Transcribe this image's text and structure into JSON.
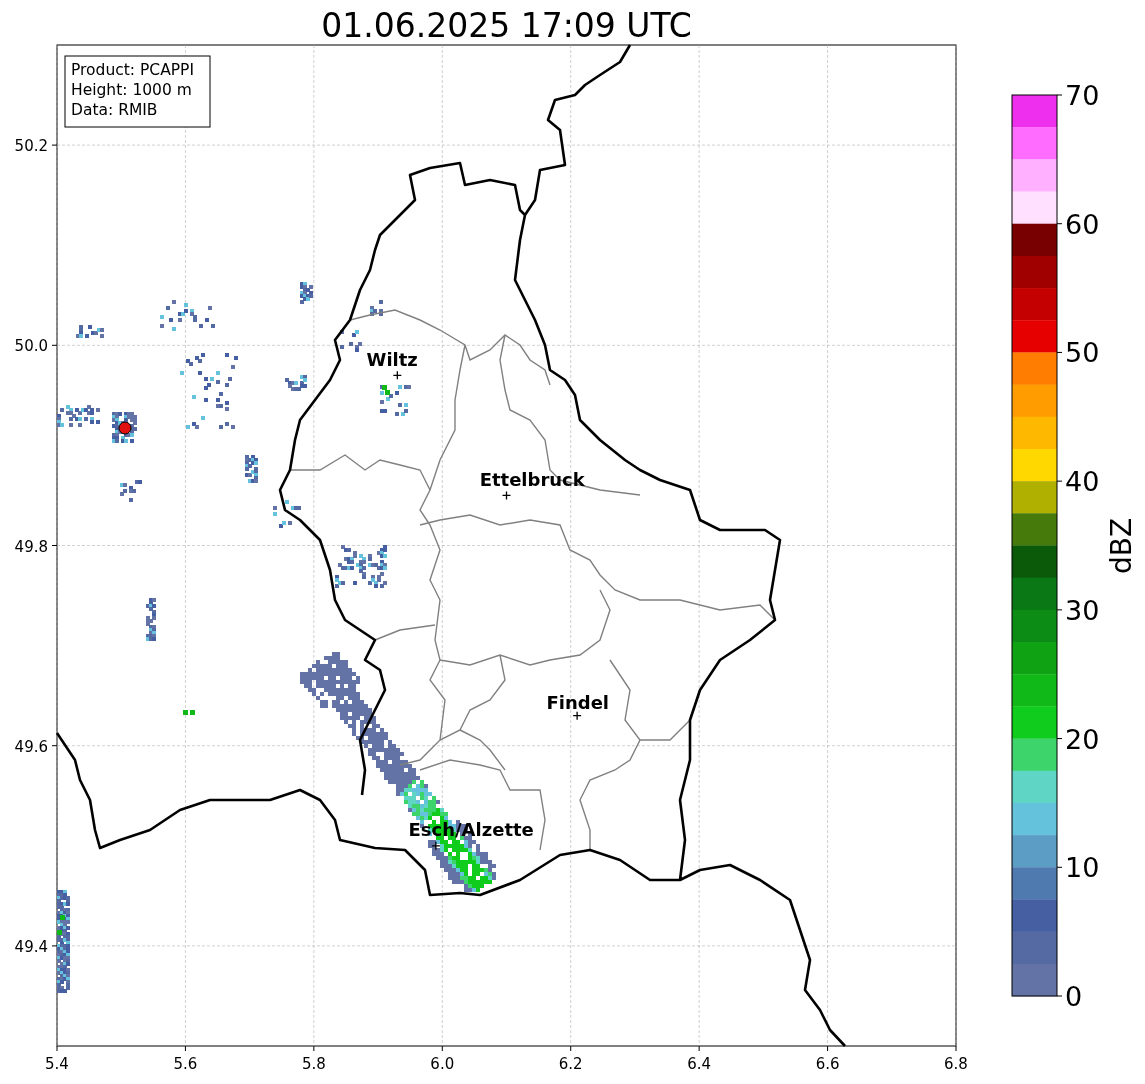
{
  "title": "01.06.2025 17:09 UTC",
  "info_box": [
    "Product: PCAPPI",
    "Height: 1000 m",
    "Data: RMIB"
  ],
  "map": {
    "x_ticks": [
      "5.4",
      "5.6",
      "5.8",
      "6.0",
      "6.2",
      "6.4",
      "6.6",
      "6.8"
    ],
    "y_ticks": [
      "50.2",
      "50.0",
      "49.8",
      "49.6",
      "49.4"
    ],
    "cities": [
      {
        "label": "Wiltz"
      },
      {
        "label": "Ettelbruck"
      },
      {
        "label": "Findel"
      },
      {
        "label": "Esch/Alzette"
      }
    ]
  },
  "colorbar": {
    "label": "dBZ",
    "ticks": [
      "70",
      "60",
      "50",
      "40",
      "30",
      "20",
      "10",
      "0"
    ],
    "bins": [
      {
        "color": "#ee30ee"
      },
      {
        "color": "#ff6cff"
      },
      {
        "color": "#ffb0ff"
      },
      {
        "color": "#ffe0ff"
      },
      {
        "color": "#780000"
      },
      {
        "color": "#a00000"
      },
      {
        "color": "#c40000"
      },
      {
        "color": "#e60000"
      },
      {
        "color": "#ff7d00"
      },
      {
        "color": "#ff9c00"
      },
      {
        "color": "#ffb800"
      },
      {
        "color": "#ffd800"
      },
      {
        "color": "#b0b000"
      },
      {
        "color": "#467a0a"
      },
      {
        "color": "#0a5a0a"
      },
      {
        "color": "#0a7814"
      },
      {
        "color": "#0c8c14"
      },
      {
        "color": "#0fa314"
      },
      {
        "color": "#10b818"
      },
      {
        "color": "#10cc1c"
      },
      {
        "color": "#3ed46c"
      },
      {
        "color": "#5fd6c5"
      },
      {
        "color": "#64c2dc"
      },
      {
        "color": "#5b9dc5"
      },
      {
        "color": "#4e7ab0"
      },
      {
        "color": "#455fa2"
      },
      {
        "color": "#556aa2"
      },
      {
        "color": "#6473a5"
      }
    ]
  }
}
